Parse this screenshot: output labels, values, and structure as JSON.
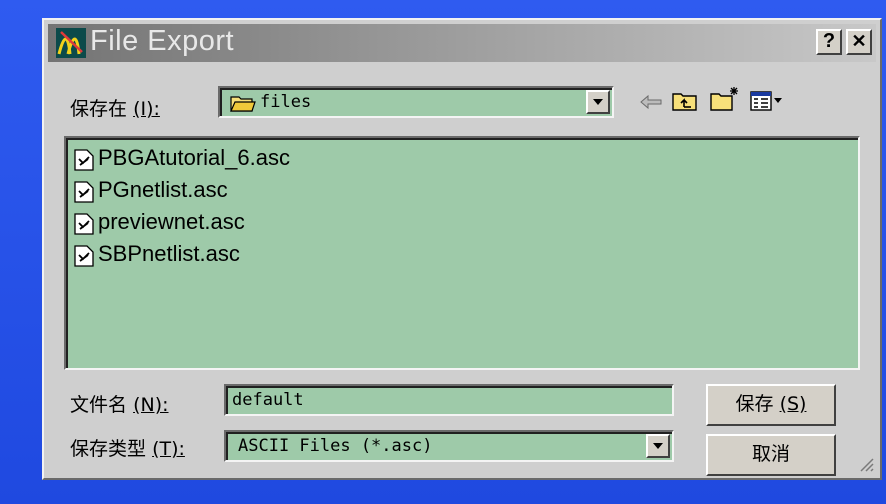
{
  "window": {
    "title": "File Export",
    "help_label": "?",
    "close_label": "✕"
  },
  "save_in": {
    "label": "保存在",
    "accel": "(I):",
    "folder": "files"
  },
  "files": [
    "PBGAtutorial_6.asc",
    "PGnetlist.asc",
    "previewnet.asc",
    "SBPnetlist.asc"
  ],
  "filename": {
    "label": "文件名",
    "accel": "(N):",
    "value": "default"
  },
  "filetype": {
    "label": "保存类型",
    "accel": "(T):",
    "value": "ASCII Files (*.asc)"
  },
  "buttons": {
    "save_label": "保存",
    "save_accel": "(S)",
    "cancel_label": "取消"
  },
  "colors": {
    "desktop": "#2b55e8",
    "dialog": "#cfcfcf",
    "field": "#9ecaa9"
  }
}
